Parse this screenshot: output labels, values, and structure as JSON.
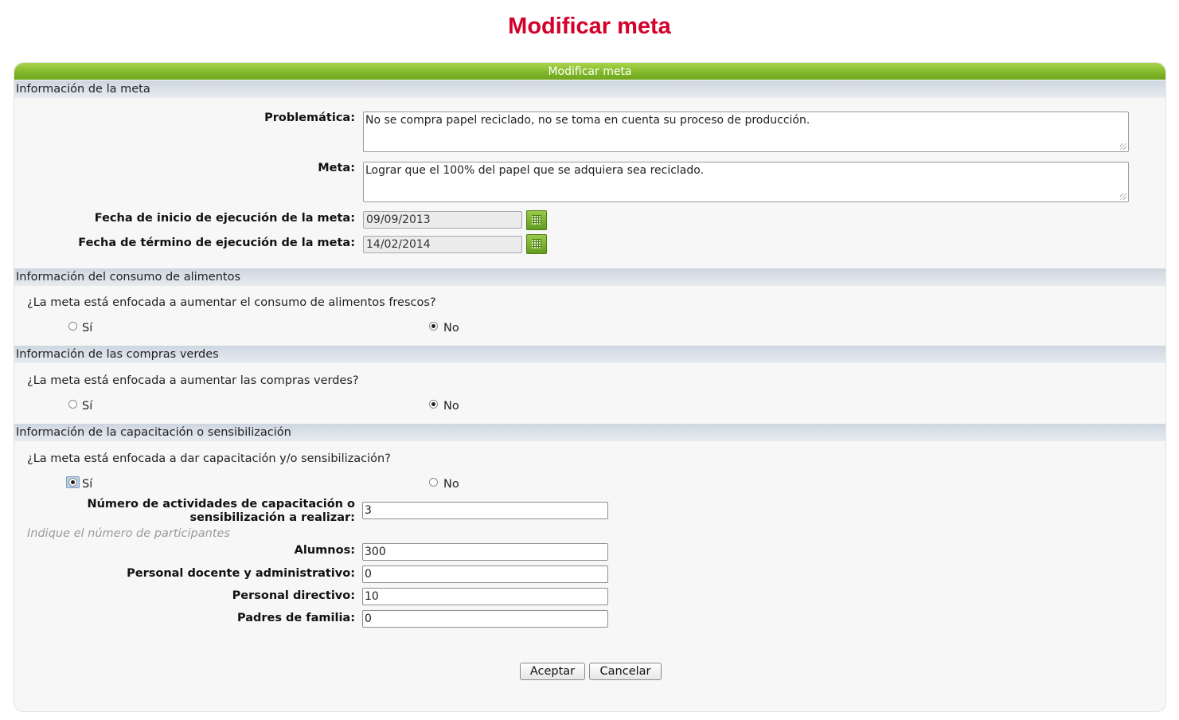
{
  "page": {
    "title": "Modificar meta"
  },
  "panel": {
    "header": "Modificar meta"
  },
  "sections": {
    "meta_info": "Información de la meta",
    "food": "Información del consumo de alimentos",
    "green": "Información de las compras verdes",
    "training": "Información de la capacitación o sensibilización"
  },
  "meta": {
    "problematica_label": "Problemática:",
    "problematica_value": "No se compra papel reciclado, no se toma en cuenta su proceso de producción.",
    "meta_label": "Meta:",
    "meta_value": "Lograr que el 100% del papel que se adquiera sea reciclado.",
    "start_label": "Fecha de inicio de ejecución de la meta:",
    "start_value": "09/09/2013",
    "end_label": "Fecha de término de ejecución de la meta:",
    "end_value": "14/02/2014"
  },
  "food": {
    "question": "¿La meta está enfocada a aumentar el consumo de alimentos frescos?",
    "yes": "Sí",
    "no": "No",
    "selected": "No"
  },
  "green": {
    "question": "¿La meta está enfocada a aumentar las compras verdes?",
    "yes": "Sí",
    "no": "No",
    "selected": "No"
  },
  "training": {
    "question": "¿La meta está enfocada a dar capacitación y/o sensibilización?",
    "yes": "Sí",
    "no": "No",
    "selected": "Sí",
    "activities_label_1": "Número de actividades de capacitación o",
    "activities_label_2": "sensibilización a realizar:",
    "activities_value": "3",
    "hint": "Indique el número de participantes",
    "alumnos_label": "Alumnos:",
    "alumnos_value": "300",
    "docente_label": "Personal docente y administrativo:",
    "docente_value": "0",
    "directivo_label": "Personal directivo:",
    "directivo_value": "10",
    "padres_label": "Padres de familia:",
    "padres_value": "0"
  },
  "buttons": {
    "accept": "Aceptar",
    "cancel": "Cancelar"
  },
  "colors": {
    "title": "#d4002a",
    "header_green": "#82b92a",
    "section_bg": "#dde3ea"
  },
  "icons": {
    "calendar": "calendar-icon"
  }
}
